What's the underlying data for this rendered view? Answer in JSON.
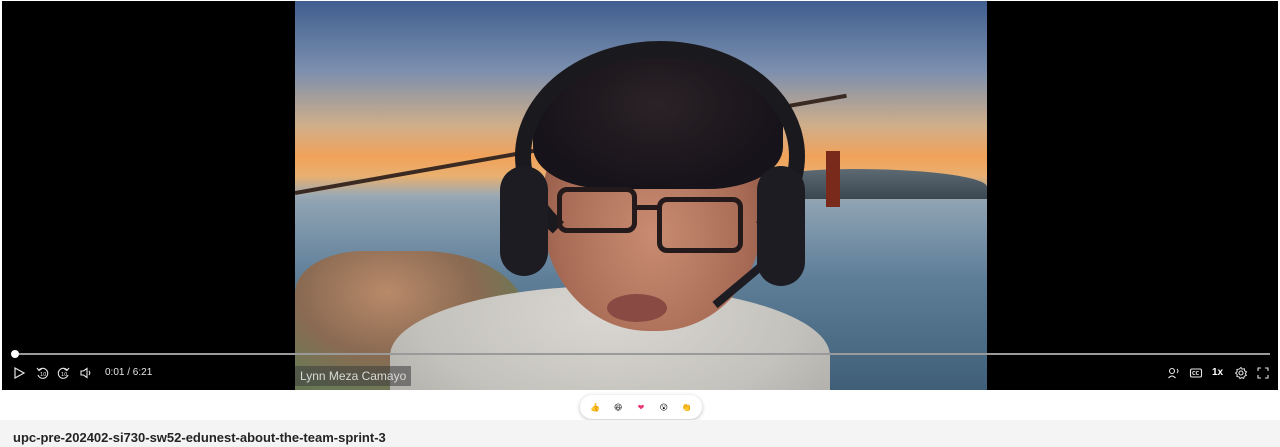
{
  "player": {
    "participant_name": "Lynn Meza Camayo",
    "time_display": "0:01 / 6:21",
    "progress_fraction": 0.003,
    "playback_speed": "1x",
    "controls_left": [
      "play-icon",
      "rewind-10-icon",
      "forward-10-icon",
      "volume-icon"
    ],
    "controls_right": [
      "live-caption-icon",
      "cc-icon",
      "speed-label",
      "settings-icon",
      "fullscreen-icon"
    ]
  },
  "reactions": [
    {
      "name": "thumbs-up-icon",
      "glyph": "👍"
    },
    {
      "name": "laugh-icon",
      "glyph": "😆"
    },
    {
      "name": "heart-icon",
      "glyph": "❤"
    },
    {
      "name": "surprised-icon",
      "glyph": "😮"
    },
    {
      "name": "clap-icon",
      "glyph": "👏"
    }
  ],
  "video": {
    "title": "upc-pre-202402-si730-sw52-edunest-about-the-team-sprint-3"
  },
  "colors": {
    "player_bg": "#000000",
    "progress_track": "#9a9a9a",
    "progress_fill": "#ffffff",
    "heart": "#e83a72",
    "emoji_yellow": "#f5b82e"
  }
}
